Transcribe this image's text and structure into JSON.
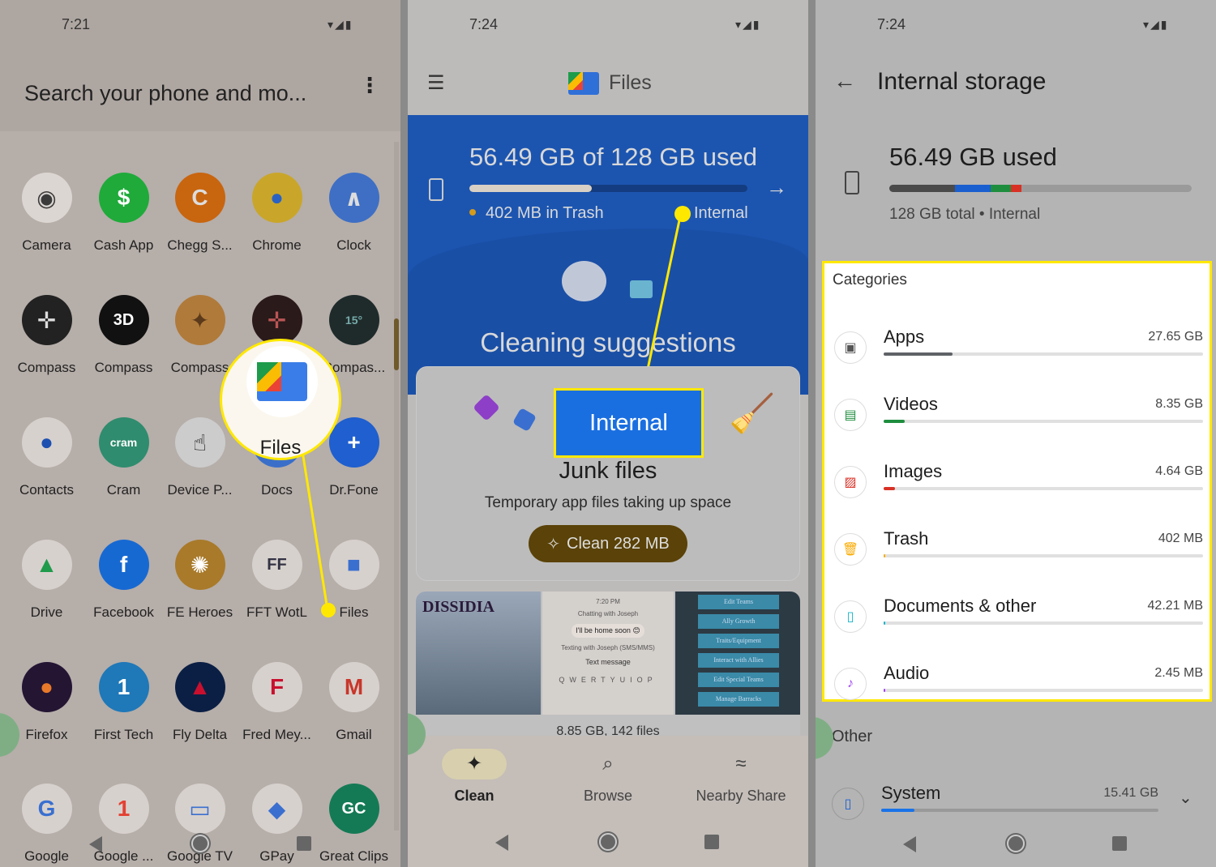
{
  "launcher": {
    "time": "7:21",
    "search_placeholder": "Search your phone and mo...",
    "apps": [
      {
        "label": "Camera",
        "icon": "camera-icon",
        "color": "#3b3b3b",
        "bg": "#dcd6d2",
        "glyph": "◉"
      },
      {
        "label": "Cash App",
        "icon": "cash-app-icon",
        "color": "#fff",
        "bg": "#1faa3a",
        "glyph": "$"
      },
      {
        "label": "Chegg S...",
        "icon": "chegg-icon",
        "color": "#ddd",
        "bg": "#c8650f",
        "glyph": "C"
      },
      {
        "label": "Chrome",
        "icon": "chrome-icon",
        "color": "#2a62c4",
        "bg": "#c9a62a",
        "glyph": "●"
      },
      {
        "label": "Clock",
        "icon": "clock-icon",
        "color": "#ddd",
        "bg": "#3e6fc4",
        "glyph": "∧"
      },
      {
        "label": "Compass",
        "icon": "compass-icon",
        "color": "#ddd",
        "bg": "#222",
        "glyph": "✛"
      },
      {
        "label": "Compass",
        "icon": "compass-3d-icon",
        "color": "#fff",
        "bg": "#111",
        "glyph": "3D"
      },
      {
        "label": "Compass",
        "icon": "compass-rose-icon",
        "color": "#5a3a1a",
        "bg": "#b07a3a",
        "glyph": "✦"
      },
      {
        "label": "",
        "icon": "compass-dark-icon",
        "color": "#b55",
        "bg": "#2a1a1a",
        "glyph": "✛"
      },
      {
        "label": "Compas...",
        "icon": "compass-dial-icon",
        "color": "#7aa",
        "bg": "#1f2b2b",
        "glyph": "15°"
      },
      {
        "label": "Contacts",
        "icon": "contacts-icon",
        "color": "#1c4fb0",
        "bg": "#d7d1cd",
        "glyph": "●"
      },
      {
        "label": "Cram",
        "icon": "cram-icon",
        "color": "#fff",
        "bg": "#2f8c6e",
        "glyph": "cram"
      },
      {
        "label": "Device P...",
        "icon": "device-icon",
        "color": "#111",
        "bg": "#ccc",
        "glyph": "☝"
      },
      {
        "label": "Docs",
        "icon": "docs-icon",
        "color": "#fff",
        "bg": "#3a6fc9",
        "glyph": "≡"
      },
      {
        "label": "Dr.Fone",
        "icon": "drfone-icon",
        "color": "#fff",
        "bg": "#1f5fcf",
        "glyph": "+"
      },
      {
        "label": "Drive",
        "icon": "drive-icon",
        "color": "#1f9b4b",
        "bg": "#d7d1cd",
        "glyph": "▲"
      },
      {
        "label": "Facebook",
        "icon": "facebook-icon",
        "color": "#fff",
        "bg": "#1769d2",
        "glyph": "f"
      },
      {
        "label": "FE Heroes",
        "icon": "fe-heroes-icon",
        "color": "#fff",
        "bg": "#a87a2a",
        "glyph": "✺"
      },
      {
        "label": "FFT WotL",
        "icon": "fft-icon",
        "color": "#334",
        "bg": "#d7d1cd",
        "glyph": "FF"
      },
      {
        "label": "Files",
        "icon": "files-icon",
        "color": "#3a6fd0",
        "bg": "#d7d1cd",
        "glyph": "■"
      },
      {
        "label": "Firefox",
        "icon": "firefox-icon",
        "color": "#e8792a",
        "bg": "#241533",
        "glyph": "●"
      },
      {
        "label": "First Tech",
        "icon": "first-tech-icon",
        "color": "#fff",
        "bg": "#1f78b8",
        "glyph": "1"
      },
      {
        "label": "Fly Delta",
        "icon": "delta-icon",
        "color": "#c8102e",
        "bg": "#0b1f44",
        "glyph": "▲"
      },
      {
        "label": "Fred Mey...",
        "icon": "fred-meyer-icon",
        "color": "#c8102e",
        "bg": "#d7d1cd",
        "glyph": "F"
      },
      {
        "label": "Gmail",
        "icon": "gmail-icon",
        "color": "#c8362a",
        "bg": "#d7d1cd",
        "glyph": "M"
      },
      {
        "label": "Google",
        "icon": "google-icon",
        "color": "#3a6fd0",
        "bg": "#d7d1cd",
        "glyph": "G"
      },
      {
        "label": "Google ...",
        "icon": "google-one-icon",
        "color": "#e34133",
        "bg": "#d7d1cd",
        "glyph": "1"
      },
      {
        "label": "Google TV",
        "icon": "google-tv-icon",
        "color": "#3a6fd0",
        "bg": "#d7d1cd",
        "glyph": "▭"
      },
      {
        "label": "GPay",
        "icon": "gpay-icon",
        "color": "#3a6fd0",
        "bg": "#d7d1cd",
        "glyph": "◆"
      },
      {
        "label": "Great Clips",
        "icon": "great-clips-icon",
        "color": "#fff",
        "bg": "#147a55",
        "glyph": "GC"
      }
    ],
    "callout_label": "Files"
  },
  "files": {
    "time": "7:24",
    "title": "Files",
    "storage_used": "56.49 GB of 128 GB used",
    "used_fraction": 0.4413,
    "trash": "402 MB in Trash",
    "volume": "Internal",
    "section_title": "Cleaning suggestions",
    "callout_label": "Internal",
    "card_title": "Junk files",
    "card_subtitle": "Temporary app files taking up space",
    "clean_button": "Clean 282 MB",
    "thumb_text": {
      "chat_time": "7:20 PM",
      "chat_with": "Chatting with Joseph",
      "message": "I'll be home soon 😊",
      "texting": "Texting with Joseph (SMS/MMS)",
      "input": "Text message",
      "game_menu": [
        "Edit Teams",
        "Ally Growth",
        "Traits/Equipment",
        "Interact with Allies",
        "Edit Special Teams",
        "Manage Barracks"
      ],
      "dissidia": "DISSIDIA"
    },
    "media_summary": "8.85 GB, 142 files",
    "tabs": [
      {
        "label": "Clean",
        "icon": "sparkle-icon",
        "active": true
      },
      {
        "label": "Browse",
        "icon": "browse-folder-icon",
        "active": false
      },
      {
        "label": "Nearby Share",
        "icon": "nearby-share-icon",
        "active": false
      }
    ]
  },
  "storage": {
    "time": "7:24",
    "title": "Internal storage",
    "used": "56.49 GB used",
    "subtitle": "128 GB total • Internal",
    "categories_heading": "Categories",
    "categories": [
      {
        "name": "Apps",
        "size": "27.65 GB",
        "fraction": 0.216,
        "color": "#5f6368",
        "icon": "android-icon",
        "icon_color": "#555",
        "glyph": "▣"
      },
      {
        "name": "Videos",
        "size": "8.35 GB",
        "fraction": 0.065,
        "color": "#1e8e3e",
        "icon": "video-icon",
        "icon_color": "#1e8e3e",
        "glyph": "▤"
      },
      {
        "name": "Images",
        "size": "4.64 GB",
        "fraction": 0.036,
        "color": "#d93025",
        "icon": "image-icon",
        "icon_color": "#d93025",
        "glyph": "▨"
      },
      {
        "name": "Trash",
        "size": "402 MB",
        "fraction": 0.003,
        "color": "#f9ab00",
        "icon": "trash-icon",
        "icon_color": "#f9ab00",
        "glyph": "🗑"
      },
      {
        "name": "Documents & other",
        "size": "42.21 MB",
        "fraction": 0.0003,
        "color": "#12b5cb",
        "icon": "document-icon",
        "icon_color": "#12b5cb",
        "glyph": "▯"
      },
      {
        "name": "Audio",
        "size": "2.45 MB",
        "fraction": 2e-05,
        "color": "#a142f4",
        "icon": "music-note-icon",
        "icon_color": "#a142f4",
        "glyph": "♪"
      }
    ],
    "other_heading": "Other",
    "system": {
      "name": "System",
      "size": "15.41 GB",
      "fraction": 0.12,
      "color": "#1a73e8"
    },
    "usage_segments": [
      {
        "color": "#4a4a4a",
        "fraction": 0.216
      },
      {
        "color": "#1a5fd0",
        "fraction": 0.12
      },
      {
        "color": "#1e8e3e",
        "fraction": 0.065
      },
      {
        "color": "#d93025",
        "fraction": 0.036
      }
    ]
  },
  "accent": "#ffe800"
}
